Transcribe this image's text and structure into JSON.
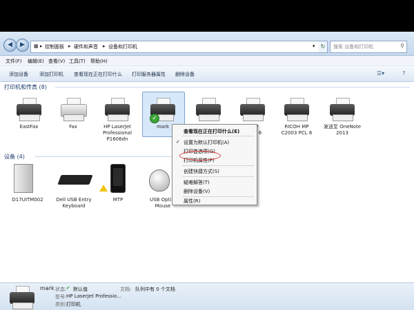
{
  "breadcrumb": [
    "控制面板",
    "硬件和声音",
    "设备和打印机"
  ],
  "search": {
    "placeholder": "搜索 设备和打印机"
  },
  "menu": [
    "文件(F)",
    "编辑(E)",
    "查看(V)",
    "工具(T)",
    "帮助(H)"
  ],
  "commands": [
    "添加设备",
    "添加打印机",
    "查看现在正在打印什么",
    "打印服务器属性",
    "删除设备"
  ],
  "printers_section": "打印机和传真 (8)",
  "devices_section": "设备 (4)",
  "printers": [
    {
      "name": "EastFax"
    },
    {
      "name": "Fax"
    },
    {
      "name": "HP LaserJet\nProfessional\nP1606dn"
    },
    {
      "name": "mark"
    },
    {
      "name": "..."
    },
    {
      "name": "...MP\n...PCL 6"
    },
    {
      "name": "RICOH MP\nC2003 PCL 6"
    },
    {
      "name": "发送至 OneNote\n2013"
    }
  ],
  "devices": [
    {
      "name": "D17UITM002"
    },
    {
      "name": "Dell USB Entry\nKeyboard"
    },
    {
      "name": "MTP"
    },
    {
      "name": "USB Opti...\nMouse"
    }
  ],
  "context_menu": {
    "items": [
      "查看现在正在打印什么(E)",
      "设置为默认打印机(A)",
      "打印首选项(G)",
      "打印机属性(P)",
      "创建快捷方式(S)",
      "疑难解答(T)",
      "删除设备(V)",
      "属性(R)"
    ]
  },
  "status": {
    "name": "mark",
    "state_label": "状态:",
    "state_value": "默认值",
    "model_label": "型号:",
    "model_value": "HP LaserJet Professio...",
    "category_label": "类别:",
    "category_value": "打印机",
    "queue_label": "文档:",
    "queue_value": "队列中有 0 个文档"
  }
}
